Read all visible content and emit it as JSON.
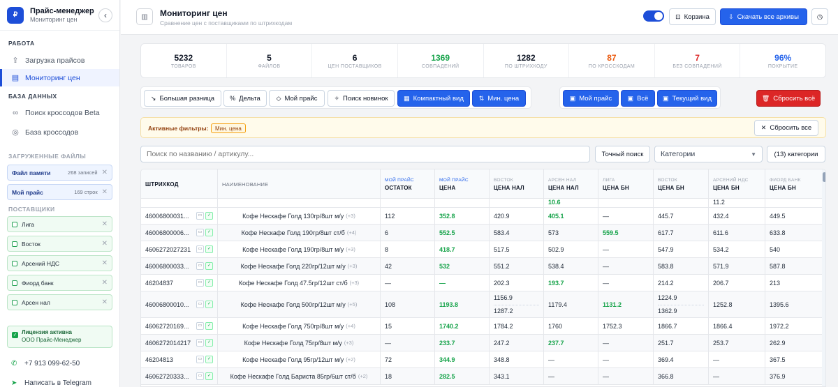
{
  "app": {
    "title": "Прайс-менеджер",
    "subtitle": "Мониторинг цен",
    "logo": "₽"
  },
  "sidebar": {
    "section_work": "РАБОТА",
    "nav": [
      {
        "label": "Загрузка прайсов",
        "icon": "upload-icon"
      },
      {
        "label": "Мониторинг цен",
        "icon": "chart-icon"
      }
    ],
    "section_db": "БАЗА ДАННЫХ",
    "db_nav": [
      {
        "label": "Поиск кроссодов Beta",
        "icon": "link-icon"
      },
      {
        "label": "База кроссодов",
        "icon": "database-icon"
      }
    ],
    "section_files": "ЗАГРУЖЕННЫЕ ФАЙЛЫ",
    "files": [
      {
        "name": "Файл памяти",
        "count": "268 записей"
      },
      {
        "name": "Мой прайс",
        "count": "169 строк"
      }
    ],
    "section_suppliers": "ПОСТАВЩИКИ",
    "suppliers": [
      "Лига",
      "Восток",
      "Арсений НДС",
      "Фиорд банк",
      "Арсен нал"
    ],
    "license_title": "Лицензия активна",
    "license_org": "ООО Прайс-Менеджер",
    "phone": "+7 913 099-62-50",
    "telegram": "Написать в Telegram"
  },
  "header": {
    "title": "Мониторинг цен",
    "subtitle": "Сравнение цен с поставщиками по штрихкодам",
    "cart": "Корзина",
    "download": "Скачать все архивы"
  },
  "stats": [
    {
      "value": "5232",
      "label": "ТОВАРОВ",
      "color": "#111827"
    },
    {
      "value": "5",
      "label": "ФАЙЛОВ",
      "color": "#111827"
    },
    {
      "value": "6",
      "label": "ЦЕН ПОСТАВЩИКОВ",
      "color": "#111827"
    },
    {
      "value": "1369",
      "label": "СОВПАДЕНИЙ",
      "color": "#16a34a"
    },
    {
      "value": "1282",
      "label": "ПО ШТРИХКОДУ",
      "color": "#111827"
    },
    {
      "value": "87",
      "label": "ПО КРОССКОДАМ",
      "color": "#ea580c"
    },
    {
      "value": "7",
      "label": "БЕЗ СОВПАДЕНИЙ",
      "color": "#dc2626"
    },
    {
      "value": "96%",
      "label": "ПОКРЫТИЕ",
      "color": "#2563eb"
    }
  ],
  "toolbar": {
    "big_diff": "Большая разница",
    "delta": "Дельта",
    "my_price": "Мой прайс",
    "new_search": "Поиск новинок",
    "compact": "Компактный вид",
    "min_price": "Мин. цена",
    "ex_my_price": "Мой прайс",
    "ex_all": "Всё",
    "ex_current": "Текущий вид",
    "reset_all": "Сбросить всё"
  },
  "filters": {
    "label": "Активные фильтры:",
    "tag": "Мин. цена",
    "reset": "Сбросить все"
  },
  "search": {
    "placeholder": "Поиск по названию / артикулу...",
    "exact": "Точный поиск",
    "category": "Категории",
    "count": "(13) категории"
  },
  "table": {
    "headers": [
      {
        "top": "",
        "bot": "ШТРИХКОД"
      },
      {
        "top": "",
        "bot": "НАИМЕНОВАНИЕ"
      },
      {
        "top": "МОЙ ПРАЙС",
        "bot": "ОСТАТОК"
      },
      {
        "top": "МОЙ ПРАЙС",
        "bot": "ЦЕНА"
      },
      {
        "top": "ВОСТОК",
        "bot": "ЦЕНА НАЛ"
      },
      {
        "top": "АРСЕН НАЛ",
        "bot": "ЦЕНА НАЛ"
      },
      {
        "top": "ЛИГА",
        "bot": "ЦЕНА БН"
      },
      {
        "top": "ВОСТОК",
        "bot": "ЦЕНА БН"
      },
      {
        "top": "АРСЕНИЙ НДС",
        "bot": "ЦЕНА БН"
      },
      {
        "top": "ФИОРД БАНК",
        "bot": "ЦЕНА БН"
      }
    ],
    "partial": {
      "arsen": "10.6",
      "arseniy": "11.2"
    },
    "rows": [
      {
        "code": "46006800031...",
        "name": "Кофе Нескафе Голд 130гр/8шт м/у",
        "more": "(+3)",
        "stock": "112",
        "price": "352.8",
        "c1": "420.9",
        "c2": "405.1",
        "c3": "—",
        "c4": "445.7",
        "c5": "432.4",
        "c6": "449.5"
      },
      {
        "code": "46006800006...",
        "name": "Кофе Нескафе Голд 190гр/8шт ст/б",
        "more": "(+4)",
        "stock": "6",
        "price": "552.5",
        "c1": "583.4",
        "c2": "573",
        "c3": "559.5",
        "c4": "617.7",
        "c5": "611.6",
        "c6": "633.8"
      },
      {
        "code": "4606272027231",
        "name": "Кофе Нескафе Голд 190гр/8шт м/у",
        "more": "(+3)",
        "stock": "8",
        "price": "418.7",
        "c1": "517.5",
        "c2": "502.9",
        "c3": "—",
        "c4": "547.9",
        "c5": "534.2",
        "c6": "540"
      },
      {
        "code": "46006800033...",
        "name": "Кофе Нескафе Голд 220гр/12шт м/у",
        "more": "(+3)",
        "stock": "42",
        "price": "532",
        "c1": "551.2",
        "c2": "538.4",
        "c3": "—",
        "c4": "583.8",
        "c5": "571.9",
        "c6": "587.8"
      },
      {
        "code": "46204837",
        "name": "Кофе Нескафе Голд 47.5гр/12шт ст/б",
        "more": "(+3)",
        "stock": "—",
        "price": "—",
        "c1": "202.3",
        "c2": "193.7",
        "c3": "—",
        "c4": "214.2",
        "c5": "206.7",
        "c6": "213"
      },
      {
        "code": "46006800010...",
        "name": "Кофе Нескафе Голд 500гр/12шт м/у",
        "more": "(+5)",
        "stock": "108",
        "price": "1193.8",
        "c1": "1156.9",
        "c1b": "1287.2",
        "c2": "1179.4",
        "c3": "1131.2",
        "c4": "1224.9",
        "c4b": "1362.9",
        "c5": "1252.8",
        "c6": "1395.6"
      },
      {
        "code": "46062720169...",
        "name": "Кофе Нескафе Голд 750гр/8шт м/у",
        "more": "(+4)",
        "stock": "15",
        "price": "1740.2",
        "c1": "1784.2",
        "c2": "1760",
        "c3": "1752.3",
        "c4": "1866.7",
        "c5": "1866.4",
        "c6": "1972.2"
      },
      {
        "code": "4606272014217",
        "name": "Кофе Нескафе Голд 75гр/8шт м/у",
        "more": "(+3)",
        "stock": "—",
        "price": "233.7",
        "c1": "247.2",
        "c2": "237.7",
        "c3": "—",
        "c4": "251.7",
        "c5": "253.7",
        "c6": "262.9"
      },
      {
        "code": "46204813",
        "name": "Кофе Нескафе Голд 95гр/12шт м/у",
        "more": "(+2)",
        "stock": "72",
        "price": "344.9",
        "c1": "348.8",
        "c2": "—",
        "c3": "—",
        "c4": "369.4",
        "c5": "—",
        "c6": "367.5"
      },
      {
        "code": "46062720333...",
        "name": "Кофе Нескафе Голд Бариста 85гр/6шт ст/б",
        "more": "(+2)",
        "stock": "18",
        "price": "282.5",
        "c1": "343.1",
        "c2": "—",
        "c3": "—",
        "c4": "366.8",
        "c5": "—",
        "c6": "376.9"
      }
    ]
  }
}
